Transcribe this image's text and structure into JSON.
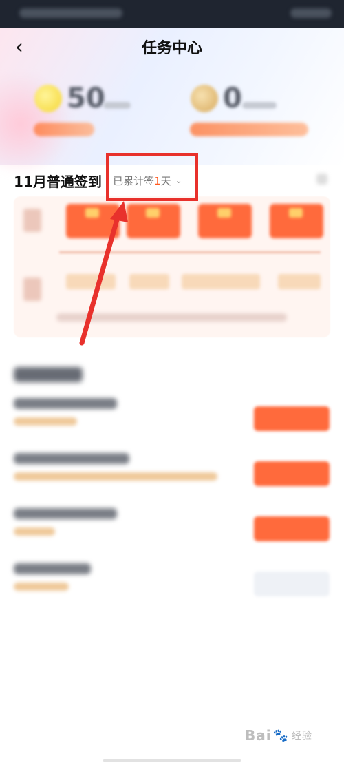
{
  "nav": {
    "back_icon": "chevron-left-icon",
    "back_glyph": "‹",
    "title": "任务中心"
  },
  "stats": [
    {
      "value": "50",
      "icon": "coin-icon",
      "color": "#f5d531"
    },
    {
      "value": "0",
      "icon": "medal-icon",
      "color": "#d7a95c"
    }
  ],
  "signin": {
    "title": "11月普通签到",
    "count_prefix": "已累计签",
    "count_days": "1",
    "count_suffix": "天",
    "chevron": "⌄"
  },
  "watermark": {
    "brand_a": "Bai",
    "paw": "🐾",
    "brand_b": "经验"
  },
  "colors": {
    "accent": "#ff6a3c",
    "highlight": "#e8312c",
    "days_number": "#ff5a1f"
  }
}
